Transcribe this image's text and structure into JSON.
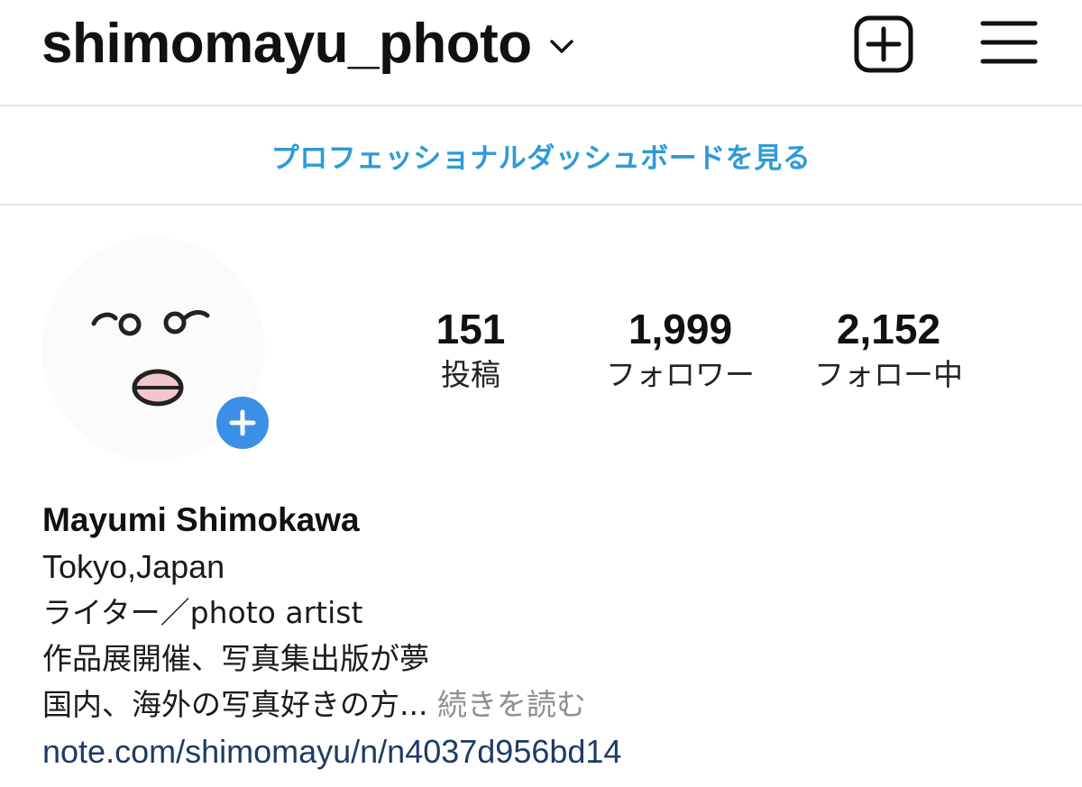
{
  "header": {
    "username": "shimomayu_photo",
    "chevron_icon": "chevron-down-icon",
    "new_post_icon": "plus-square-icon",
    "menu_icon": "hamburger-menu-icon"
  },
  "dashboard": {
    "label": "プロフェッショナルダッシュボードを見る",
    "color": "#2e9ad8"
  },
  "profile": {
    "avatar_icon": "face-drawing-avatar",
    "add_story_icon": "plus-circle-icon",
    "add_story_color": "#3b8fe6"
  },
  "stats": {
    "posts": {
      "count": "151",
      "label": "投稿"
    },
    "followers": {
      "count": "1,999",
      "label": "フォロワー"
    },
    "following": {
      "count": "2,152",
      "label": "フォロー中"
    }
  },
  "bio": {
    "name": "Mayumi Shimokawa",
    "lines": [
      "Tokyo,Japan",
      "ライター／photo artist",
      "作品展開催、写真集出版が夢"
    ],
    "truncated_line": "国内、海外の写真好きの方...",
    "more_label": "続きを読む",
    "link": "note.com/shimomayu/n/n4037d956bd14",
    "link_color": "#1d3b66"
  }
}
